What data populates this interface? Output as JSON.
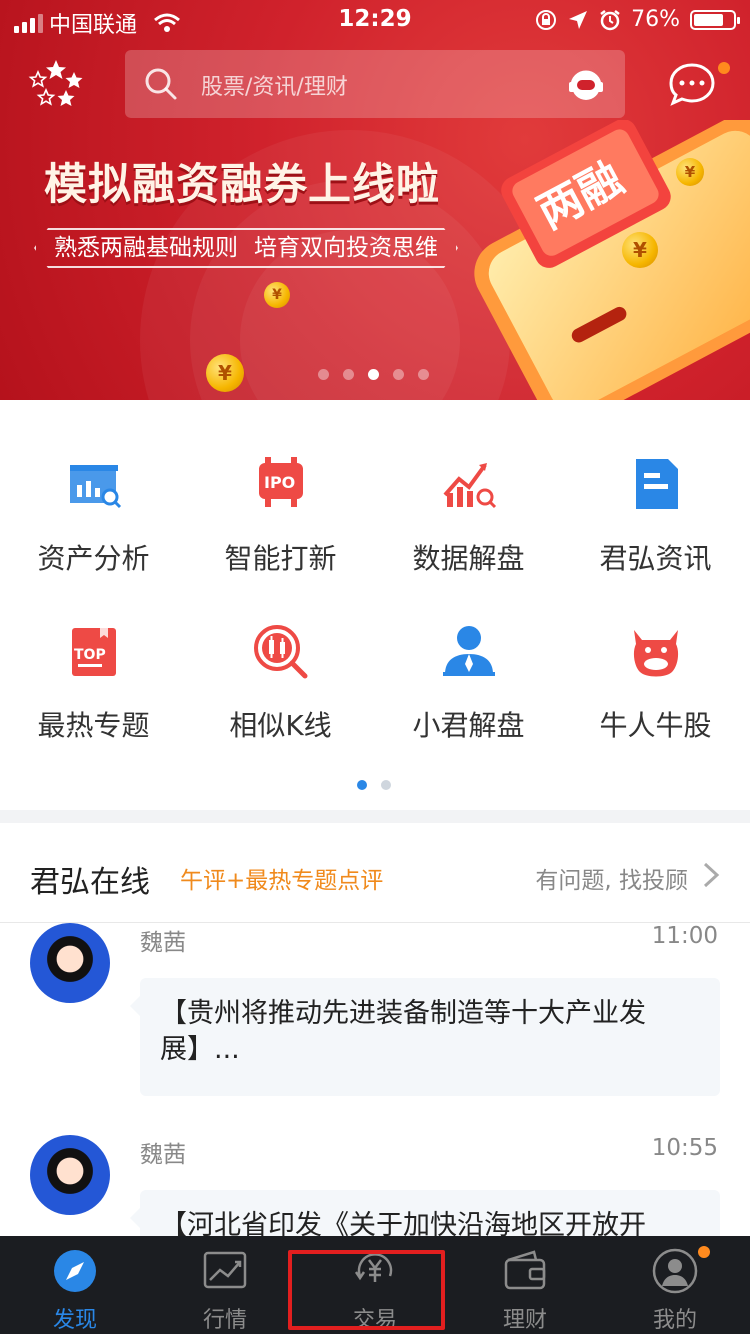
{
  "status_bar": {
    "carrier": "中国联通",
    "time": "12:29",
    "battery": "76%",
    "battery_level": 0.76
  },
  "search": {
    "placeholder": "股票/资讯/理财"
  },
  "banner": {
    "title": "模拟融资融券上线啦",
    "subtitle_left": "熟悉两融基础规则",
    "subtitle_right": "培育双向投资思维",
    "art_text": "两融",
    "coin_symbol": "¥",
    "slide_index": 3,
    "slide_count": 5
  },
  "menu": {
    "items": [
      {
        "label": "资产分析",
        "icon": "asset-analysis-icon"
      },
      {
        "label": "智能打新",
        "icon": "ipo-icon"
      },
      {
        "label": "数据解盘",
        "icon": "data-chart-icon"
      },
      {
        "label": "君弘资讯",
        "icon": "news-doc-icon"
      },
      {
        "label": "最热专题",
        "icon": "top-topic-icon"
      },
      {
        "label": "相似K线",
        "icon": "kline-search-icon"
      },
      {
        "label": "小君解盘",
        "icon": "advisor-person-icon"
      },
      {
        "label": "牛人牛股",
        "icon": "bull-icon"
      }
    ],
    "ipo_badge": "IPO",
    "top_badge": "TOP",
    "page_index": 1,
    "page_count": 2
  },
  "online": {
    "title": "君弘在线",
    "topic": "午评+最热专题点评",
    "ask": "有问题, 找投顾",
    "posts": [
      {
        "name": "魏茜",
        "time": "11:00",
        "text": "【贵州将推动先进装备制造等十大产业发展】..."
      },
      {
        "name": "魏茜",
        "time": "10:55",
        "text": "【河北省印发《关于加快沿海地区开放开"
      }
    ]
  },
  "tabbar": {
    "tabs": [
      {
        "label": "发现",
        "icon": "compass-icon",
        "active": true
      },
      {
        "label": "行情",
        "icon": "market-chart-icon",
        "active": false
      },
      {
        "label": "交易",
        "icon": "trade-yuan-icon",
        "active": false
      },
      {
        "label": "理财",
        "icon": "wallet-icon",
        "active": false
      },
      {
        "label": "我的",
        "icon": "profile-icon",
        "active": false
      }
    ]
  },
  "colors": {
    "accent": "#2a87e6",
    "banner_red": "#d0222c",
    "topic_orange": "#f08a1c",
    "badge_orange": "#ff8a1e",
    "highlight_red": "#e21f1f"
  }
}
